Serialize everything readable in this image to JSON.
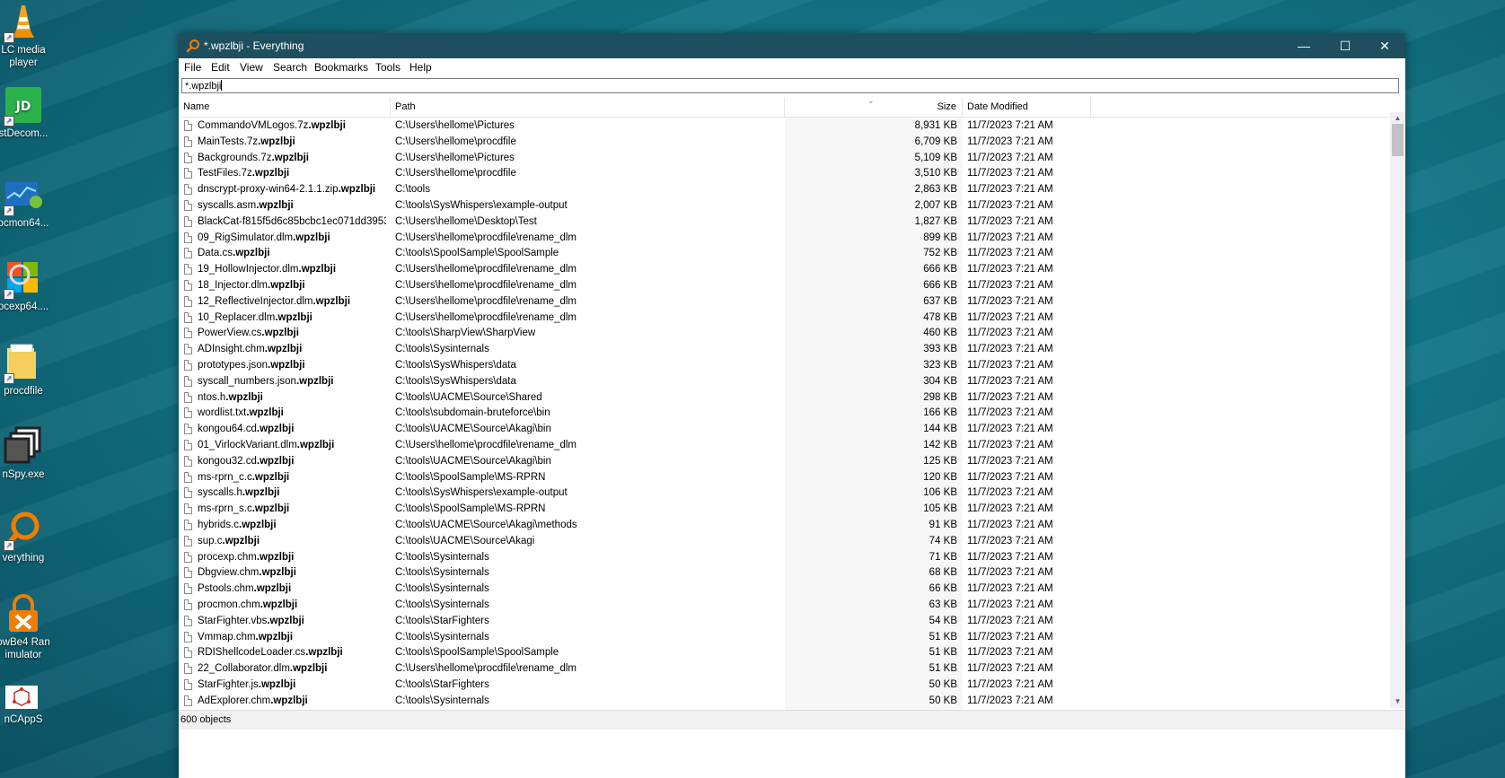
{
  "desktop": {
    "icons": [
      {
        "label": "LC media\nplayer",
        "icon": "vlc-cone-icon"
      },
      {
        "label": "stDecom...",
        "icon": "jd-icon"
      },
      {
        "label": "ocmon64...",
        "icon": "procmon-icon"
      },
      {
        "label": "ocexp64....",
        "icon": "procexp-icon"
      },
      {
        "label": "procdfile",
        "icon": "folder-icon"
      },
      {
        "label": "nSpy.exe",
        "icon": "winspy-icon"
      },
      {
        "label": "verything",
        "icon": "everything-icon"
      },
      {
        "label": "owBe4 Ran\nimulator",
        "icon": "ransim-icon"
      },
      {
        "label": "nCAppS",
        "icon": "molecule-icon"
      }
    ]
  },
  "window": {
    "title": "*.wpzlbji - Everything",
    "controls": {
      "minimize": "—",
      "maximize": "☐",
      "close": "✕"
    },
    "menu": [
      "File",
      "Edit",
      "View",
      "Search",
      "Bookmarks",
      "Tools",
      "Help"
    ],
    "search_value": "*.wpzlbji",
    "columns": {
      "name": "Name",
      "path": "Path",
      "size": "Size",
      "date": "Date Modified"
    },
    "status": "600 objects"
  },
  "files": [
    {
      "base": "CommandoVMLogos.7z",
      "ext": ".wpzlbji",
      "path": "C:\\Users\\hellome\\Pictures",
      "size": "8,931 KB",
      "date": "11/7/2023 7:21 AM"
    },
    {
      "base": "MainTests.7z",
      "ext": ".wpzlbji",
      "path": "C:\\Users\\hellome\\procdfile",
      "size": "6,709 KB",
      "date": "11/7/2023 7:21 AM"
    },
    {
      "base": "Backgrounds.7z",
      "ext": ".wpzlbji",
      "path": "C:\\Users\\hellome\\Pictures",
      "size": "5,109 KB",
      "date": "11/7/2023 7:21 AM"
    },
    {
      "base": "TestFiles.7z",
      "ext": ".wpzlbji",
      "path": "C:\\Users\\hellome\\procdfile",
      "size": "3,510 KB",
      "date": "11/7/2023 7:21 AM"
    },
    {
      "base": "dnscrypt-proxy-win64-2.1.1.zip",
      "ext": ".wpzlbji",
      "path": "C:\\tools",
      "size": "2,863 KB",
      "date": "11/7/2023 7:21 AM"
    },
    {
      "base": "syscalls.asm",
      "ext": ".wpzlbji",
      "path": "C:\\tools\\SysWhispers\\example-output",
      "size": "2,007 KB",
      "date": "11/7/2023 7:21 AM"
    },
    {
      "base": "BlackCat-f815f5d6c85bcbc1ec071dd3953...",
      "ext": "",
      "path": "C:\\Users\\hellome\\Desktop\\Test",
      "size": "1,827 KB",
      "date": "11/7/2023 7:21 AM"
    },
    {
      "base": "09_RigSimulator.dlm",
      "ext": ".wpzlbji",
      "path": "C:\\Users\\hellome\\procdfile\\rename_dlm",
      "size": "899 KB",
      "date": "11/7/2023 7:21 AM"
    },
    {
      "base": "Data.cs",
      "ext": ".wpzlbji",
      "path": "C:\\tools\\SpoolSample\\SpoolSample",
      "size": "752 KB",
      "date": "11/7/2023 7:21 AM"
    },
    {
      "base": "19_HollowInjector.dlm",
      "ext": ".wpzlbji",
      "path": "C:\\Users\\hellome\\procdfile\\rename_dlm",
      "size": "666 KB",
      "date": "11/7/2023 7:21 AM"
    },
    {
      "base": "18_Injector.dlm",
      "ext": ".wpzlbji",
      "path": "C:\\Users\\hellome\\procdfile\\rename_dlm",
      "size": "666 KB",
      "date": "11/7/2023 7:21 AM"
    },
    {
      "base": "12_ReflectiveInjector.dlm",
      "ext": ".wpzlbji",
      "path": "C:\\Users\\hellome\\procdfile\\rename_dlm",
      "size": "637 KB",
      "date": "11/7/2023 7:21 AM"
    },
    {
      "base": "10_Replacer.dlm",
      "ext": ".wpzlbji",
      "path": "C:\\Users\\hellome\\procdfile\\rename_dlm",
      "size": "478 KB",
      "date": "11/7/2023 7:21 AM"
    },
    {
      "base": "PowerView.cs",
      "ext": ".wpzlbji",
      "path": "C:\\tools\\SharpView\\SharpView",
      "size": "460 KB",
      "date": "11/7/2023 7:21 AM"
    },
    {
      "base": "ADInsight.chm",
      "ext": ".wpzlbji",
      "path": "C:\\tools\\Sysinternals",
      "size": "393 KB",
      "date": "11/7/2023 7:21 AM"
    },
    {
      "base": "prototypes.json",
      "ext": ".wpzlbji",
      "path": "C:\\tools\\SysWhispers\\data",
      "size": "323 KB",
      "date": "11/7/2023 7:21 AM"
    },
    {
      "base": "syscall_numbers.json",
      "ext": ".wpzlbji",
      "path": "C:\\tools\\SysWhispers\\data",
      "size": "304 KB",
      "date": "11/7/2023 7:21 AM"
    },
    {
      "base": "ntos.h",
      "ext": ".wpzlbji",
      "path": "C:\\tools\\UACME\\Source\\Shared",
      "size": "298 KB",
      "date": "11/7/2023 7:21 AM"
    },
    {
      "base": "wordlist.txt",
      "ext": ".wpzlbji",
      "path": "C:\\tools\\subdomain-bruteforce\\bin",
      "size": "166 KB",
      "date": "11/7/2023 7:21 AM"
    },
    {
      "base": "kongou64.cd",
      "ext": ".wpzlbji",
      "path": "C:\\tools\\UACME\\Source\\Akagi\\bin",
      "size": "144 KB",
      "date": "11/7/2023 7:21 AM"
    },
    {
      "base": "01_VirlockVariant.dlm",
      "ext": ".wpzlbji",
      "path": "C:\\Users\\hellome\\procdfile\\rename_dlm",
      "size": "142 KB",
      "date": "11/7/2023 7:21 AM"
    },
    {
      "base": "kongou32.cd",
      "ext": ".wpzlbji",
      "path": "C:\\tools\\UACME\\Source\\Akagi\\bin",
      "size": "125 KB",
      "date": "11/7/2023 7:21 AM"
    },
    {
      "base": "ms-rprn_c.c",
      "ext": ".wpzlbji",
      "path": "C:\\tools\\SpoolSample\\MS-RPRN",
      "size": "120 KB",
      "date": "11/7/2023 7:21 AM"
    },
    {
      "base": "syscalls.h",
      "ext": ".wpzlbji",
      "path": "C:\\tools\\SysWhispers\\example-output",
      "size": "106 KB",
      "date": "11/7/2023 7:21 AM"
    },
    {
      "base": "ms-rprn_s.c",
      "ext": ".wpzlbji",
      "path": "C:\\tools\\SpoolSample\\MS-RPRN",
      "size": "105 KB",
      "date": "11/7/2023 7:21 AM"
    },
    {
      "base": "hybrids.c",
      "ext": ".wpzlbji",
      "path": "C:\\tools\\UACME\\Source\\Akagi\\methods",
      "size": "91 KB",
      "date": "11/7/2023 7:21 AM"
    },
    {
      "base": "sup.c",
      "ext": ".wpzlbji",
      "path": "C:\\tools\\UACME\\Source\\Akagi",
      "size": "74 KB",
      "date": "11/7/2023 7:21 AM"
    },
    {
      "base": "procexp.chm",
      "ext": ".wpzlbji",
      "path": "C:\\tools\\Sysinternals",
      "size": "71 KB",
      "date": "11/7/2023 7:21 AM"
    },
    {
      "base": "Dbgview.chm",
      "ext": ".wpzlbji",
      "path": "C:\\tools\\Sysinternals",
      "size": "68 KB",
      "date": "11/7/2023 7:21 AM"
    },
    {
      "base": "Pstools.chm",
      "ext": ".wpzlbji",
      "path": "C:\\tools\\Sysinternals",
      "size": "66 KB",
      "date": "11/7/2023 7:21 AM"
    },
    {
      "base": "procmon.chm",
      "ext": ".wpzlbji",
      "path": "C:\\tools\\Sysinternals",
      "size": "63 KB",
      "date": "11/7/2023 7:21 AM"
    },
    {
      "base": "StarFighter.vbs",
      "ext": ".wpzlbji",
      "path": "C:\\tools\\StarFighters",
      "size": "54 KB",
      "date": "11/7/2023 7:21 AM"
    },
    {
      "base": "Vmmap.chm",
      "ext": ".wpzlbji",
      "path": "C:\\tools\\Sysinternals",
      "size": "51 KB",
      "date": "11/7/2023 7:21 AM"
    },
    {
      "base": "RDIShellcodeLoader.cs",
      "ext": ".wpzlbji",
      "path": "C:\\tools\\SpoolSample\\SpoolSample",
      "size": "51 KB",
      "date": "11/7/2023 7:21 AM"
    },
    {
      "base": "22_Collaborator.dlm",
      "ext": ".wpzlbji",
      "path": "C:\\Users\\hellome\\procdfile\\rename_dlm",
      "size": "51 KB",
      "date": "11/7/2023 7:21 AM"
    },
    {
      "base": "StarFighter.js",
      "ext": ".wpzlbji",
      "path": "C:\\tools\\StarFighters",
      "size": "50 KB",
      "date": "11/7/2023 7:21 AM"
    },
    {
      "base": "AdExplorer.chm",
      "ext": ".wpzlbji",
      "path": "C:\\tools\\Sysinternals",
      "size": "50 KB",
      "date": "11/7/2023 7:21 AM"
    }
  ]
}
